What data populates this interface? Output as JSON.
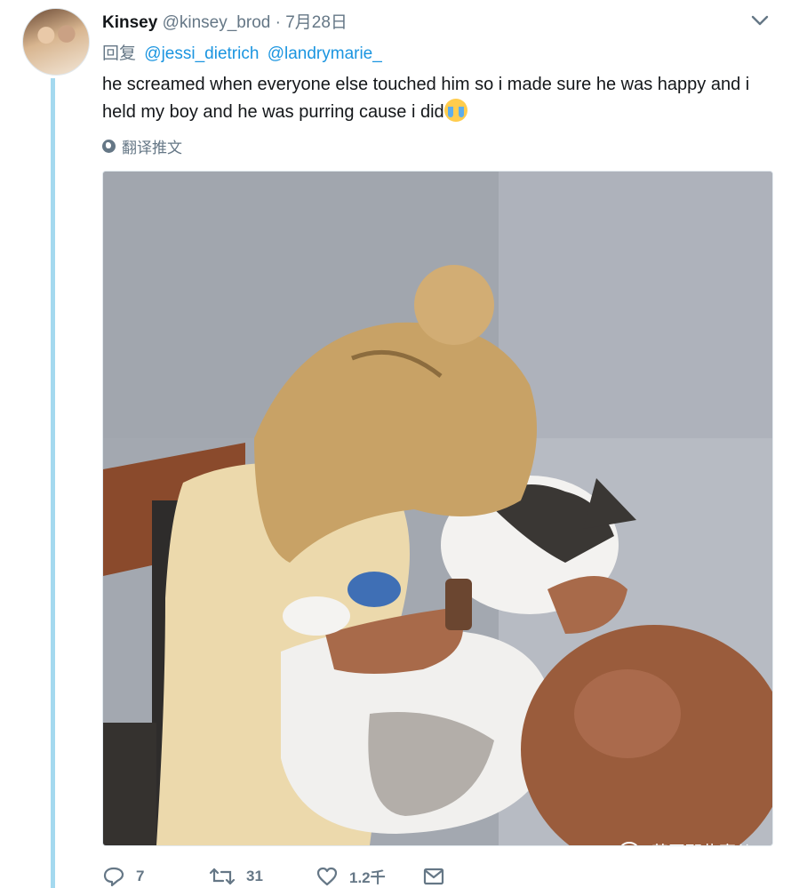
{
  "tweet": {
    "name": "Kinsey",
    "handle": "@kinsey_brod",
    "separator": "·",
    "date": "7月28日",
    "reply_prefix": "回复",
    "mentions": [
      "@jessi_dietrich",
      "@landrymarie_"
    ],
    "text": "he screamed when everyone else touched him so i made sure he was happy and i held my boy and he was purring cause i did",
    "emoji": "crying-face",
    "translate_label": "翻译推文",
    "photo_description": "woman hugging a white and gray cat"
  },
  "actions": {
    "replies": "7",
    "retweets": "31",
    "likes": "1.2千"
  },
  "icons": {
    "caret": "chevron-down-icon",
    "globe": "globe-icon",
    "reply": "reply-icon",
    "retweet": "retweet-icon",
    "like": "heart-icon",
    "message": "envelope-icon",
    "watermark": "wechat-icon"
  },
  "watermark": {
    "text": "英国那些事儿"
  },
  "colors": {
    "link": "#1b95e0",
    "muted": "#657786",
    "thread_line": "#a4d9ef"
  }
}
